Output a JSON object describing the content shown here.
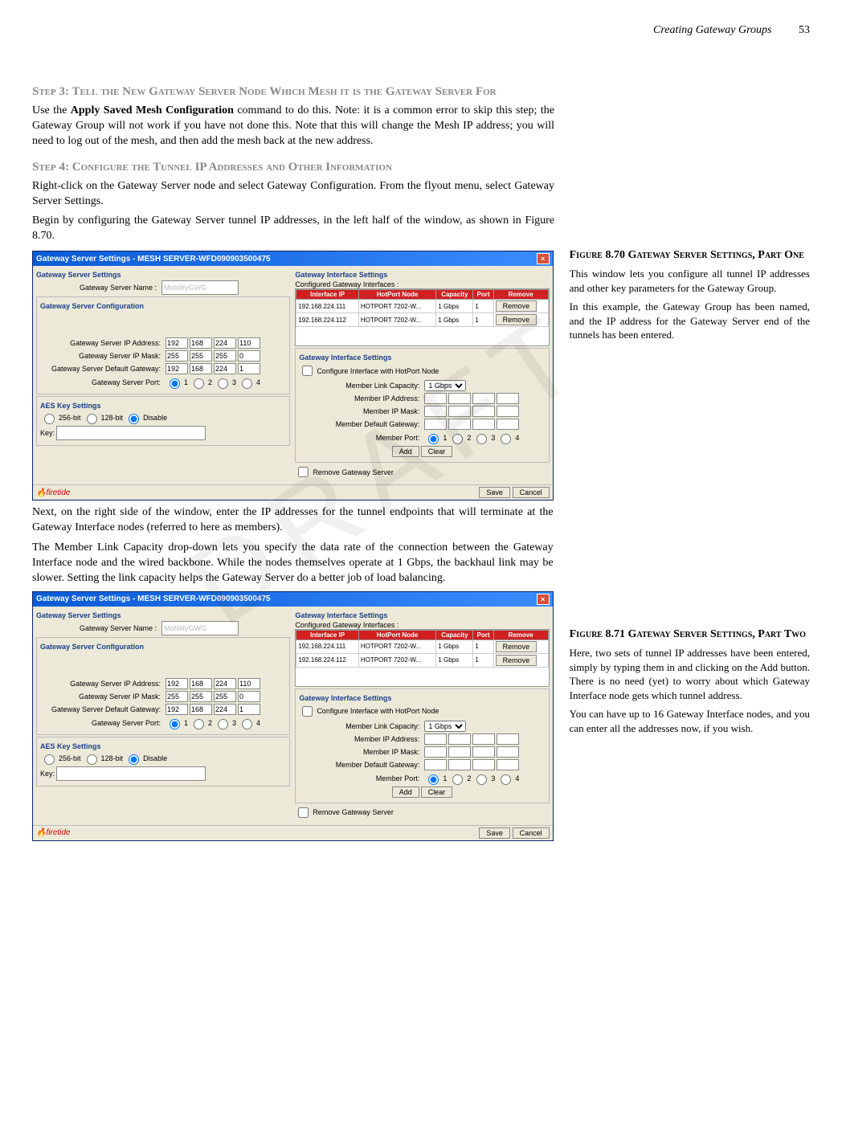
{
  "header": {
    "section": "Creating Gateway Groups",
    "page": "53"
  },
  "step3": {
    "title": "Step 3: Tell the New Gateway Server Node Which Mesh it is the Gateway Server For",
    "body": "Use the Apply Saved Mesh Configuration command to do this. Note: it is a common error to skip this step; the Gateway Group will not work if you have not done this. Note that this will change the Mesh IP address; you will need to log out of the mesh, and then add the mesh back at the new address.",
    "bold": "Apply Saved Mesh Configuration"
  },
  "step4": {
    "title": "Step 4: Configure the Tunnel IP Addresses and Other Information",
    "p1": "Right-click on the Gateway Server node and select Gateway Configuration. From the flyout menu, select Gateway Server Settings.",
    "p2": "Begin by configuring the Gateway Server tunnel IP addresses, in the left half of the window, as shown in Figure 8.70.",
    "p3": "Next, on the right side of the window, enter the IP addresses for the tunnel endpoints that will terminate at the Gateway Interface nodes (referred to here as members).",
    "p4": "The Member Link Capacity drop-down lets you specify the data rate of the connection between the Gateway Interface node and the wired backbone. While the nodes themselves operate at 1 Gbps, the backhaul link may be slower. Setting the link capacity helps the Gateway Server do a better job of load balancing."
  },
  "fig70": {
    "title": "Figure 8.70 Gateway Server Settings, Part One",
    "p1": "This window lets you configure all tunnel IP addresses and other key parameters for the Gateway Group.",
    "p2": "In this example, the Gateway Group has been named, and the IP address for the Gateway Server end of the tunnels has been entered."
  },
  "fig71": {
    "title": "Figure 8.71 Gateway Server Settings, Part Two",
    "p1": "Here, two sets of tunnel IP addresses have been entered, simply by typing them in and clicking on the Add button. There is no need (yet) to worry about which Gateway Interface node gets which tunnel address.",
    "p2": "You can have up to 16 Gateway Interface nodes, and you can enter all the addresses now, if you wish."
  },
  "dialog": {
    "title": "Gateway Server Settings - MESH SERVER-WFD090903500475",
    "gss": "Gateway Server Settings",
    "gsn": "Gateway Server Name :",
    "name_val": "MobilityGWG",
    "gsc": "Gateway Server Configuration",
    "ip_label": "Gateway Server IP Address:",
    "mask_label": "Gateway Server IP Mask:",
    "gw_label": "Gateway Server Default Gateway:",
    "port_label": "Gateway Server Port:",
    "ip": [
      "192",
      "168",
      "224",
      "110"
    ],
    "mask": [
      "255",
      "255",
      "255",
      "0"
    ],
    "gw": [
      "192",
      "168",
      "224",
      "1"
    ],
    "aes": "AES Key Settings",
    "aes256": "256-bit",
    "aes128": "128-bit",
    "aesdis": "Disable",
    "key": "Key:",
    "gis": "Gateway Interface Settings",
    "cgi": "Configured Gateway Interfaces :",
    "th": [
      "Interface IP",
      "HotPort Node",
      "Capacity",
      "Port",
      "Remove"
    ],
    "rows": [
      [
        "192.168.224.111",
        "HOTPORT 7202-W...",
        "1 Gbps",
        "1",
        "Remove"
      ],
      [
        "192.168.224.112",
        "HOTPORT 7202-W...",
        "1 Gbps",
        "1",
        "Remove"
      ]
    ],
    "cfgchk": "Configure Interface with HotPort Node",
    "mlc": "Member Link Capacity:",
    "mlc_val": "1 Gbps",
    "mip": "Member IP Address:",
    "mmask": "Member IP Mask:",
    "mgw": "Member Default Gateway:",
    "mport": "Member Port:",
    "add": "Add",
    "clear": "Clear",
    "rgs": "Remove Gateway Server",
    "save": "Save",
    "cancel": "Cancel",
    "brand": "firetide"
  },
  "watermark": "DRAFT"
}
